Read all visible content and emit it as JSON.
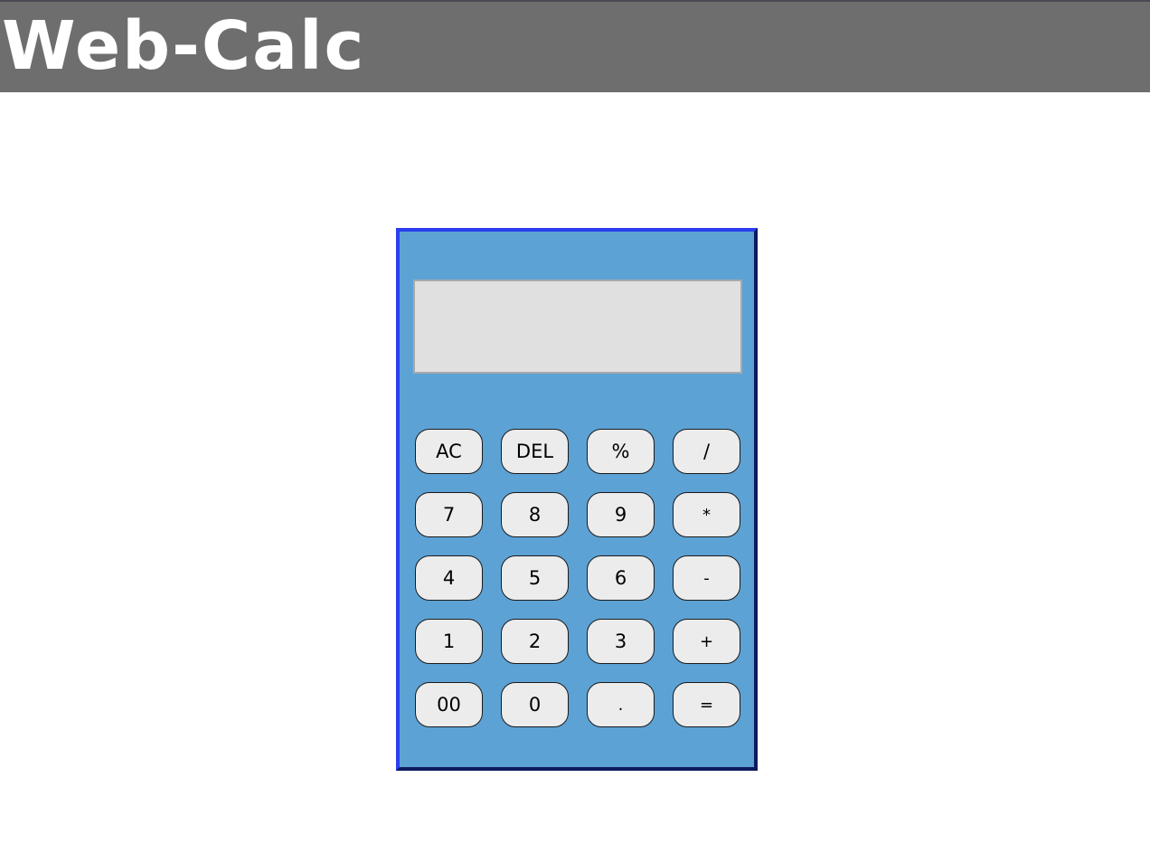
{
  "header": {
    "title": "Web-Calc",
    "background": "#6e6e6e",
    "text_color": "#ffffff"
  },
  "calculator": {
    "body_color": "#5da2d5",
    "border_color": "#2b3ff0",
    "display": {
      "value": "",
      "background": "#e0e0e0"
    },
    "key_color": "#ececec",
    "keys": [
      [
        "AC",
        "DEL",
        "%",
        "/"
      ],
      [
        "7",
        "8",
        "9",
        "*"
      ],
      [
        "4",
        "5",
        "6",
        "-"
      ],
      [
        "1",
        "2",
        "3",
        "+"
      ],
      [
        "00",
        "0",
        ".",
        "="
      ]
    ]
  }
}
